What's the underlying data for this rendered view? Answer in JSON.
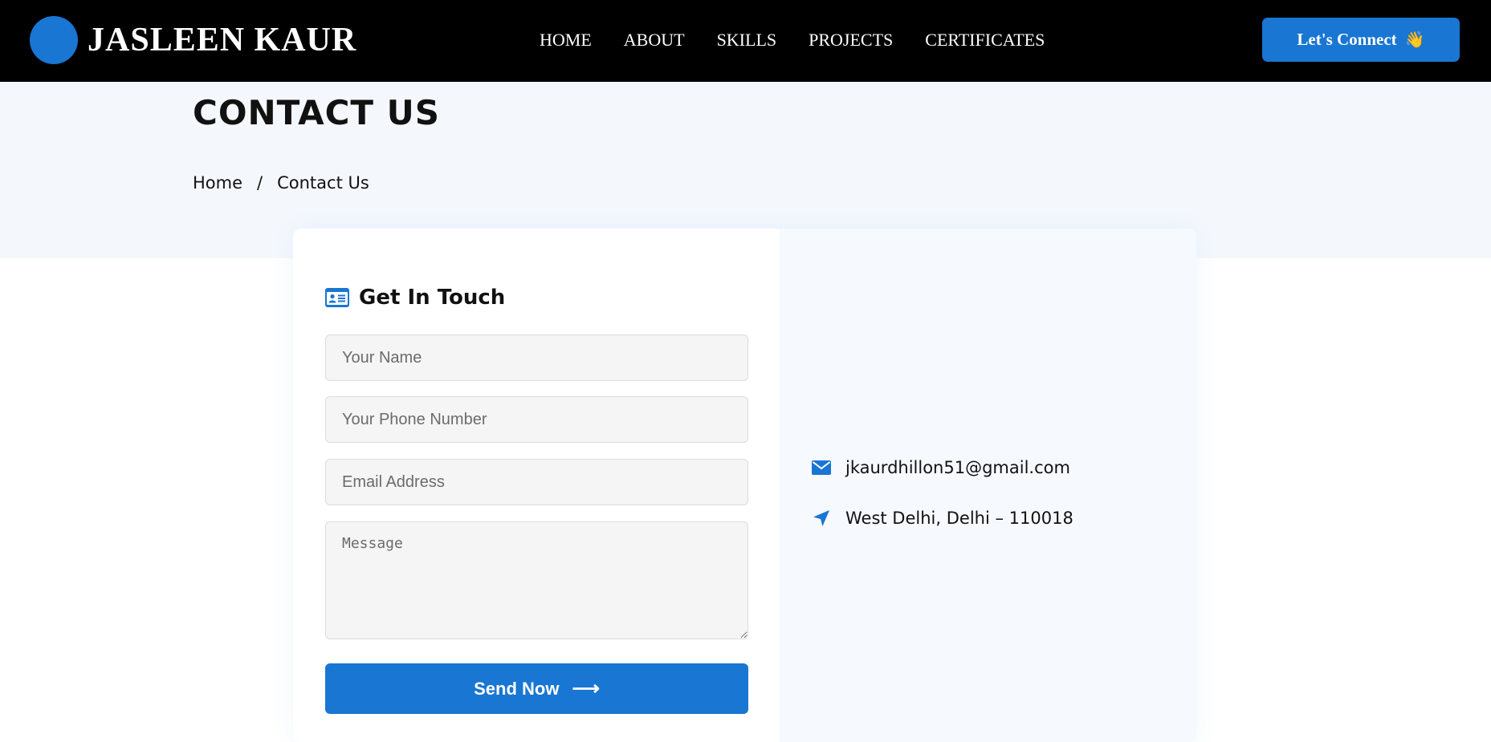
{
  "navbar": {
    "brand": "JASLEEN KAUR",
    "links": [
      "HOME",
      "ABOUT",
      "SKILLS",
      "PROJECTS",
      "CERTIFICATES"
    ],
    "cta_label": "Let's Connect",
    "cta_emoji": "👋"
  },
  "hero": {
    "title": "CONTACT US",
    "breadcrumb": {
      "home": "Home",
      "separator": "/",
      "current": "Contact Us"
    }
  },
  "form": {
    "heading": "Get In Touch",
    "heading_icon": "contact-card-icon",
    "name_placeholder": "Your Name",
    "phone_placeholder": "Your Phone Number",
    "email_placeholder": "Email Address",
    "message_placeholder": "Message",
    "submit_label": "Send Now",
    "submit_arrow": "⟶"
  },
  "contact_info": {
    "email": "jkaurdhillon51@gmail.com",
    "email_icon": "envelope-icon",
    "location": "West Delhi, Delhi – 110018",
    "location_icon": "location-arrow-icon"
  },
  "colors": {
    "accent": "#1976d2",
    "navbar_bg": "#000000",
    "hero_bg": "#f4f8fd",
    "panel_bg": "#f6f9fd"
  }
}
